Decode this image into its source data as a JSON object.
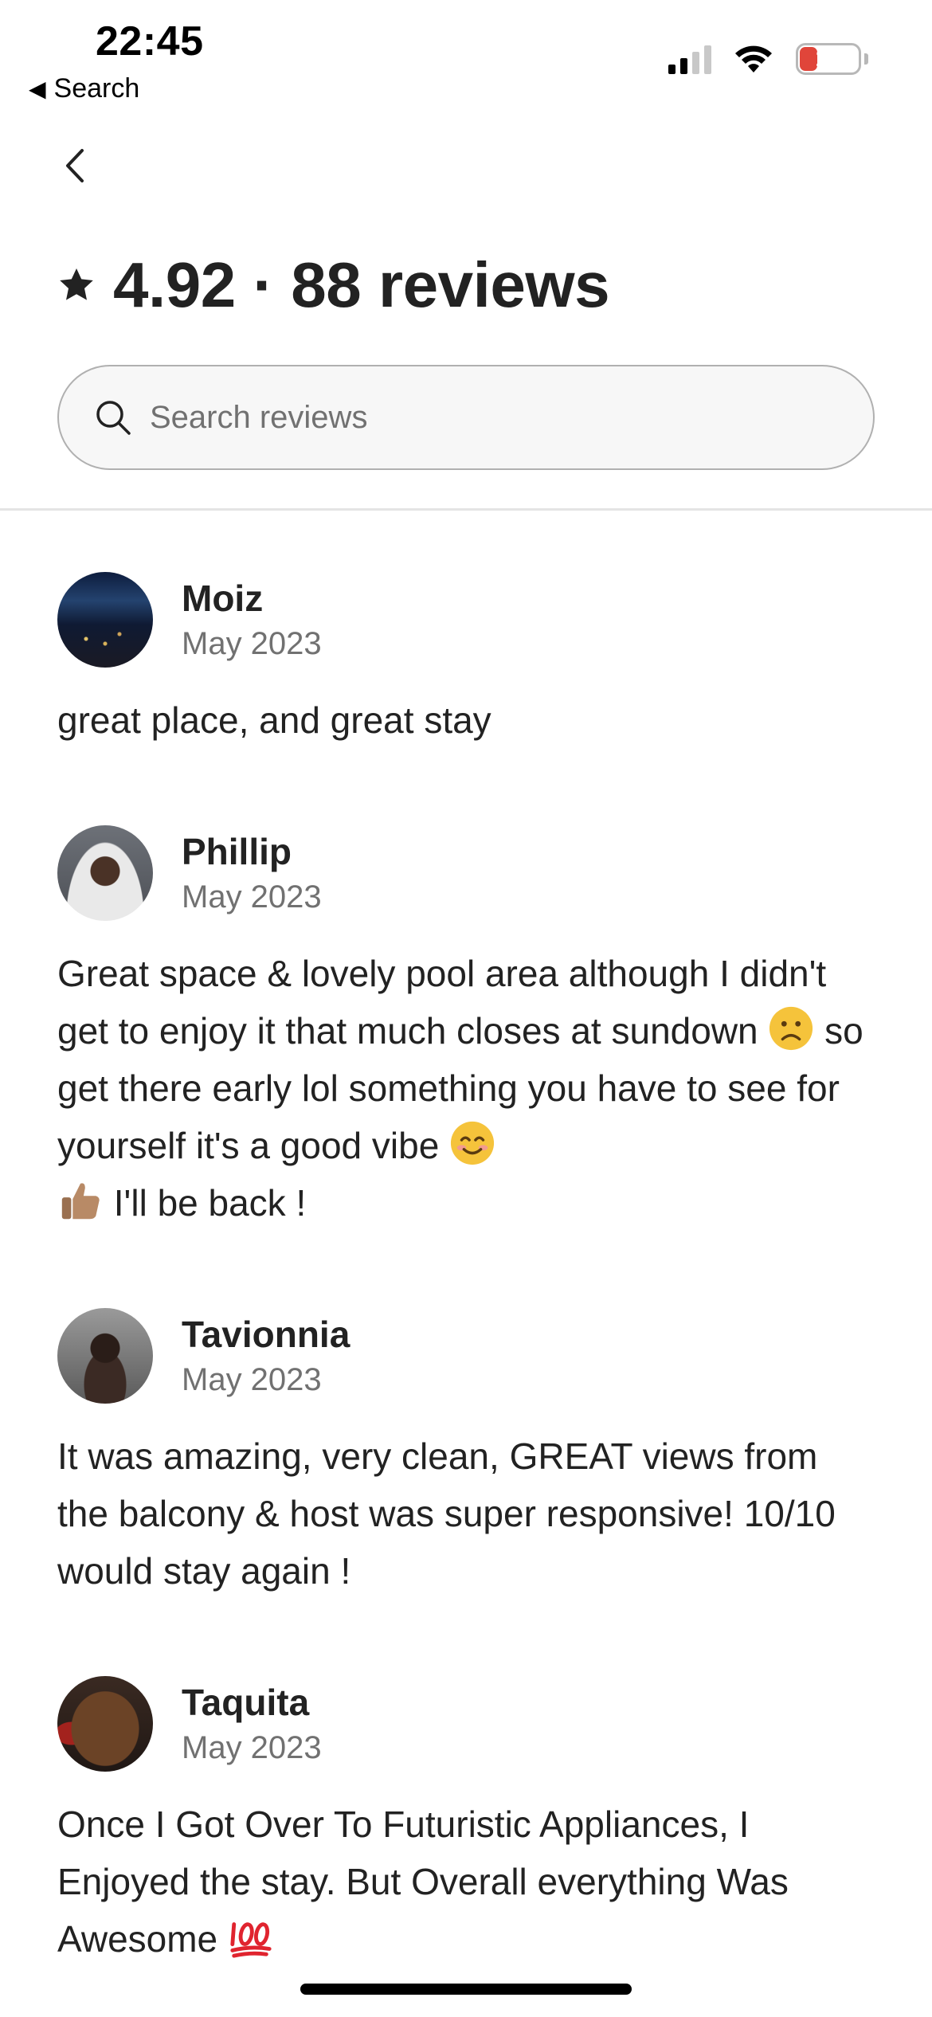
{
  "status_bar": {
    "time": "22:45",
    "back_app_label": "Search",
    "battery_level": "15",
    "signal_bars_active": 2,
    "signal_bars_total": 4
  },
  "header": {
    "title": "4.92 · 88 reviews"
  },
  "search": {
    "placeholder": "Search reviews"
  },
  "reviews": [
    {
      "name": "Moiz",
      "date": "May 2023",
      "text": "great place, and great stay"
    },
    {
      "name": "Phillip",
      "date": "May 2023",
      "text_parts": [
        "Great space & lovely pool area although I didn't get to enjoy it that much closes at sundown ",
        " so get there early lol something you have to see for yourself it's a good vibe ",
        " ",
        " I'll be back !"
      ],
      "emojis": [
        "frowning-face",
        "smiling-face",
        "thumbs-up"
      ]
    },
    {
      "name": "Tavionnia",
      "date": "May 2023",
      "text": "It was amazing, very clean, GREAT views from the balcony & host was super responsive! 10/10 would stay again !"
    },
    {
      "name": "Taquita",
      "date": "May 2023",
      "text_parts": [
        "Once I Got Over To Futuristic Appliances, I Enjoyed the stay. But Overall everything Was Awesome ",
        ""
      ],
      "emojis": [
        "hundred-points"
      ]
    }
  ],
  "colors": {
    "text_primary": "#222222",
    "text_secondary": "#717171",
    "battery_low": "#e0453a"
  }
}
